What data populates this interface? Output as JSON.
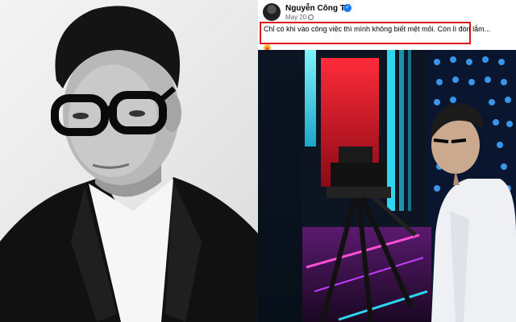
{
  "post": {
    "author_name": "Nguyễn Công Trí",
    "date": "May 20 · ",
    "caption_line1": "Chỉ có khi vào công việc thì mình không biết mệt mỏi. Còn lì đòn lắm...",
    "caption_emoji": "😍"
  },
  "icons": {
    "verified": "verified-badge-icon",
    "audience": "globe-icon",
    "emoji": "heart-eyes-emoji"
  },
  "colors": {
    "highlight_box": "#e0191f",
    "verified_blue": "#1877f2"
  }
}
